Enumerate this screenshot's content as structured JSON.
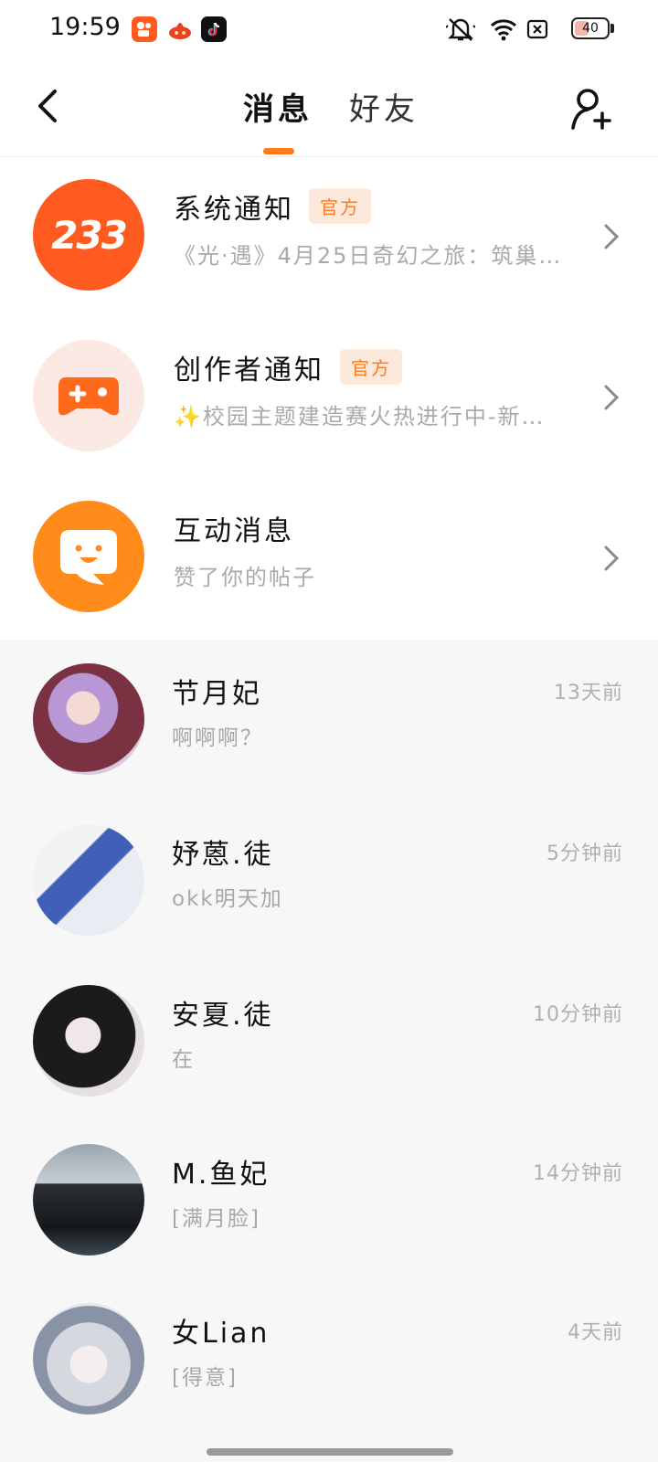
{
  "status_bar": {
    "time": "19:59",
    "battery": "40",
    "icons": [
      "kuaishou-app-icon",
      "huoshan-app-icon",
      "douyin-app-icon",
      "mute-icon",
      "wifi-icon",
      "no-sim-icon",
      "battery-icon"
    ]
  },
  "header": {
    "tabs": [
      {
        "label": "消息",
        "active": true
      },
      {
        "label": "好友",
        "active": false
      }
    ],
    "back_icon": "chevron-left-icon",
    "add_friend_icon": "person-add-icon",
    "accent": "#ff7a1a"
  },
  "official": [
    {
      "title": "系统通知",
      "badge": "官方",
      "subtitle": "《光·遇》4月25日奇幻之旅：筑巢…",
      "avatar_text": "233",
      "avatar_color": "#ff5a1f"
    },
    {
      "title": "创作者通知",
      "badge": "官方",
      "subtitle": "✨校园主题建造赛火热进行中-新…",
      "avatar_icon": "gamepad-plus-icon",
      "avatar_color": "#fde9e3"
    },
    {
      "title": "互动消息",
      "subtitle": "赞了你的帖子",
      "avatar_icon": "smile-bubble-icon",
      "avatar_color": "#ff8c1a"
    }
  ],
  "chats": [
    {
      "name": "节月妃",
      "message": "啊啊啊？",
      "time": "13天前"
    },
    {
      "name": "妤蒽.徒",
      "message": "okk明天加",
      "time": "5分钟前"
    },
    {
      "name": "安夏.徒",
      "message": "在",
      "time": "10分钟前"
    },
    {
      "name": "M.鱼妃",
      "message": "[满月脸]",
      "time": "14分钟前"
    },
    {
      "name": "女Lian",
      "message": "[得意]",
      "time": "4天前"
    }
  ]
}
